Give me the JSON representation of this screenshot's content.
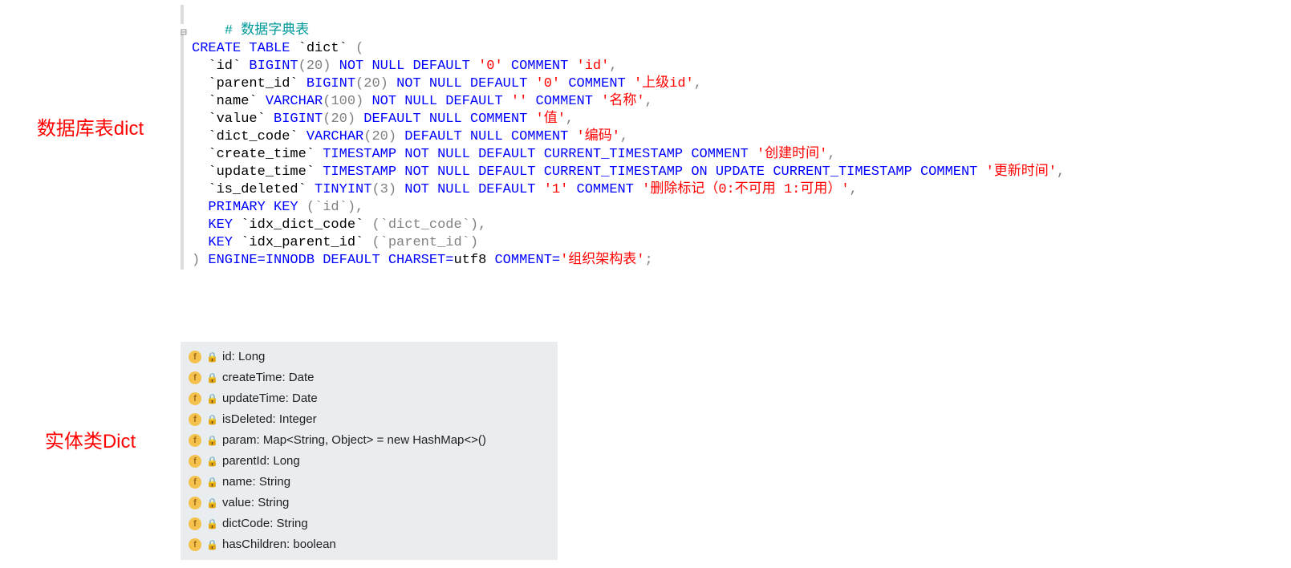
{
  "labels": {
    "db_table": "数据库表dict",
    "entity": "实体类Dict"
  },
  "sql": {
    "comment": "# 数据字典表",
    "create": "CREATE TABLE",
    "table_name": "`dict`",
    "columns": [
      {
        "name": "`id`",
        "type": "BIGINT",
        "len": "(20)",
        "flags": "NOT NULL DEFAULT",
        "default": "'0'",
        "kw2": "COMMENT",
        "comment": "'id'",
        "tail": ","
      },
      {
        "name": "`parent_id`",
        "type": "BIGINT",
        "len": "(20)",
        "flags": "NOT NULL DEFAULT",
        "default": "'0'",
        "kw2": "COMMENT",
        "comment": "'上级id'",
        "tail": ","
      },
      {
        "name": "`name`",
        "type": "VARCHAR",
        "len": "(100)",
        "flags": "NOT NULL DEFAULT",
        "default": "''",
        "kw2": "COMMENT",
        "comment": "'名称'",
        "tail": ","
      },
      {
        "name": "`value`",
        "type": "BIGINT",
        "len": "(20)",
        "flags": "DEFAULT NULL COMMENT",
        "default": "",
        "kw2": "",
        "comment": "'值'",
        "tail": ","
      },
      {
        "name": "`dict_code`",
        "type": "VARCHAR",
        "len": "(20)",
        "flags": "DEFAULT NULL COMMENT",
        "default": "",
        "kw2": "",
        "comment": "'编码'",
        "tail": ","
      },
      {
        "name": "`create_time`",
        "type": "TIMESTAMP",
        "len": "",
        "flags": "NOT NULL DEFAULT CURRENT_TIMESTAMP COMMENT",
        "default": "",
        "kw2": "",
        "comment": "'创建时间'",
        "tail": ","
      },
      {
        "name": "`update_time`",
        "type": "TIMESTAMP",
        "len": "",
        "flags": "NOT NULL DEFAULT CURRENT_TIMESTAMP ON UPDATE CURRENT_TIMESTAMP COMMENT",
        "default": "",
        "kw2": "",
        "comment": "'更新时间'",
        "tail": ","
      },
      {
        "name": "`is_deleted`",
        "type": "TINYINT",
        "len": "(3)",
        "flags": "NOT NULL DEFAULT",
        "default": "'1'",
        "kw2": "COMMENT",
        "comment": "'删除标记（0:不可用 1:可用）'",
        "tail": ","
      }
    ],
    "pk": {
      "kw": "PRIMARY KEY",
      "val": "(`id`),"
    },
    "keys": [
      {
        "kw": "KEY",
        "name": "`idx_dict_code`",
        "cols": "(`dict_code`),"
      },
      {
        "kw": "KEY",
        "name": "`idx_parent_id`",
        "cols": "(`parent_id`)"
      }
    ],
    "engine_line": {
      "close": ")",
      "engine": "ENGINE=INNODB DEFAULT CHARSET=",
      "charset": "utf8",
      "kw": "COMMENT=",
      "comment": "'组织架构表'",
      "end": ";"
    }
  },
  "entity_fields": [
    "id: Long",
    "createTime: Date",
    "updateTime: Date",
    "isDeleted: Integer",
    "param: Map<String, Object> = new HashMap<>()",
    "parentId: Long",
    "name: String",
    "value: String",
    "dictCode: String",
    "hasChildren: boolean"
  ]
}
